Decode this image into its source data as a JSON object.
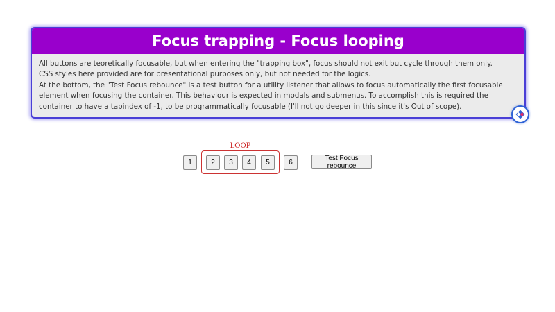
{
  "card": {
    "title": "Focus trapping - Focus looping",
    "lines": [
      "All buttons are teoretically focusable, but when entering the \"trapping box\", focus should not exit but cycle through them only.",
      "CSS styles here provided are for presentational purposes only, but not needed for the logics.",
      "At the bottom, the \"Test Focus rebounce\" is a test button for a utility listener that allows to focus automatically the first focusable element when focusing the container. This behaviour is expected in modals and submenus. To accomplish this is required the container to have a tabindex of -1, to be programmatically focusable (I'll not go deeper in this since it's Out of scope)."
    ],
    "logo_icon": "codepen-style-logo-icon"
  },
  "trap": {
    "label": "LOOP"
  },
  "buttons": {
    "b1": "1",
    "b2": "2",
    "b3": "3",
    "b4": "4",
    "b5": "5",
    "b6": "6",
    "rebounce": "Test Focus rebounce"
  },
  "colors": {
    "header_bg": "#9900cc",
    "card_border": "#4a3fd6",
    "card_bg": "#ebebeb",
    "trap_border": "#cc3333",
    "loop_text": "#cc2222"
  }
}
